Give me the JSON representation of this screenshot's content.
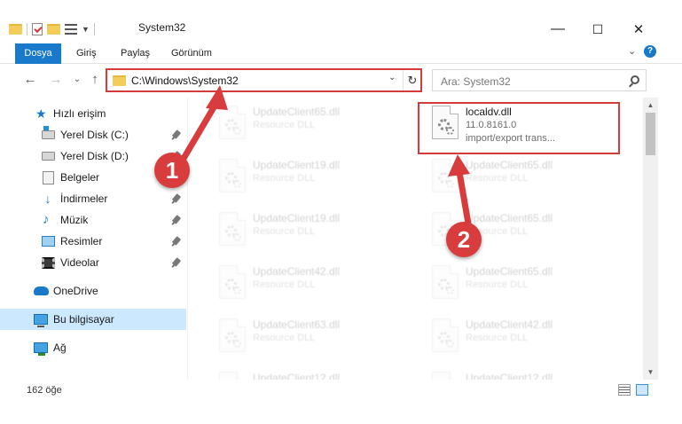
{
  "window": {
    "title": "System32",
    "minimize": "—",
    "maximize": "☐",
    "close": "✕"
  },
  "ribbon": {
    "tabs": [
      {
        "label": "Dosya"
      },
      {
        "label": "Giriş"
      },
      {
        "label": "Paylaş"
      },
      {
        "label": "Görünüm"
      }
    ],
    "expand": "⌄",
    "help": "?"
  },
  "nav": {
    "back": "←",
    "forward": "→",
    "recent": "⌄",
    "up": "↑"
  },
  "address": {
    "path": "C:\\Windows\\System32",
    "dropdown": "⌄",
    "refresh": "↻"
  },
  "search": {
    "placeholder": "Ara: System32"
  },
  "sidebar": {
    "items": [
      {
        "label": "Hızlı erişim"
      },
      {
        "label": "Yerel Disk (C:)"
      },
      {
        "label": "Yerel Disk (D:)"
      },
      {
        "label": "Belgeler"
      },
      {
        "label": "İndirmeler"
      },
      {
        "label": "Müzik"
      },
      {
        "label": "Resimler"
      },
      {
        "label": "Videolar"
      },
      {
        "label": "OneDrive"
      },
      {
        "label": "Bu bilgisayar"
      },
      {
        "label": "Ağ"
      }
    ]
  },
  "files": {
    "highlighted": {
      "name": "localdv.dll",
      "version": "11.0.8161.0",
      "description": "import/export trans..."
    },
    "left_column": [
      {
        "name": "UpdateClient65.dll",
        "type": "Resource DLL"
      },
      {
        "name": "UpdateClient19.dll",
        "type": "Resource DLL"
      },
      {
        "name": "UpdateClient19.dll",
        "type": "Resource DLL"
      },
      {
        "name": "UpdateClient42.dll",
        "type": "Resource DLL"
      },
      {
        "name": "UpdateClient63.dll",
        "type": "Resource DLL"
      },
      {
        "name": "UpdateClient12.dll",
        "type": "Resource DLL"
      }
    ],
    "right_column": [
      {
        "name": "UpdateClient65.dll",
        "type": "Resource DLL"
      },
      {
        "name": "UpdateClient65.dll",
        "type": "Resource DLL"
      },
      {
        "name": "UpdateClient65.dll",
        "type": "Resource DLL"
      },
      {
        "name": "UpdateClient42.dll",
        "type": "Resource DLL"
      },
      {
        "name": "UpdateClient12.dll",
        "type": "Resource DLL"
      }
    ]
  },
  "status": {
    "count": "162 öğe"
  },
  "scroll": {
    "up": "▲",
    "down": "▼"
  },
  "callouts": {
    "first": "1",
    "second": "2"
  },
  "colors": {
    "accent": "#1979ca",
    "annotation": "#d63b3b",
    "selection": "#cce8ff"
  }
}
